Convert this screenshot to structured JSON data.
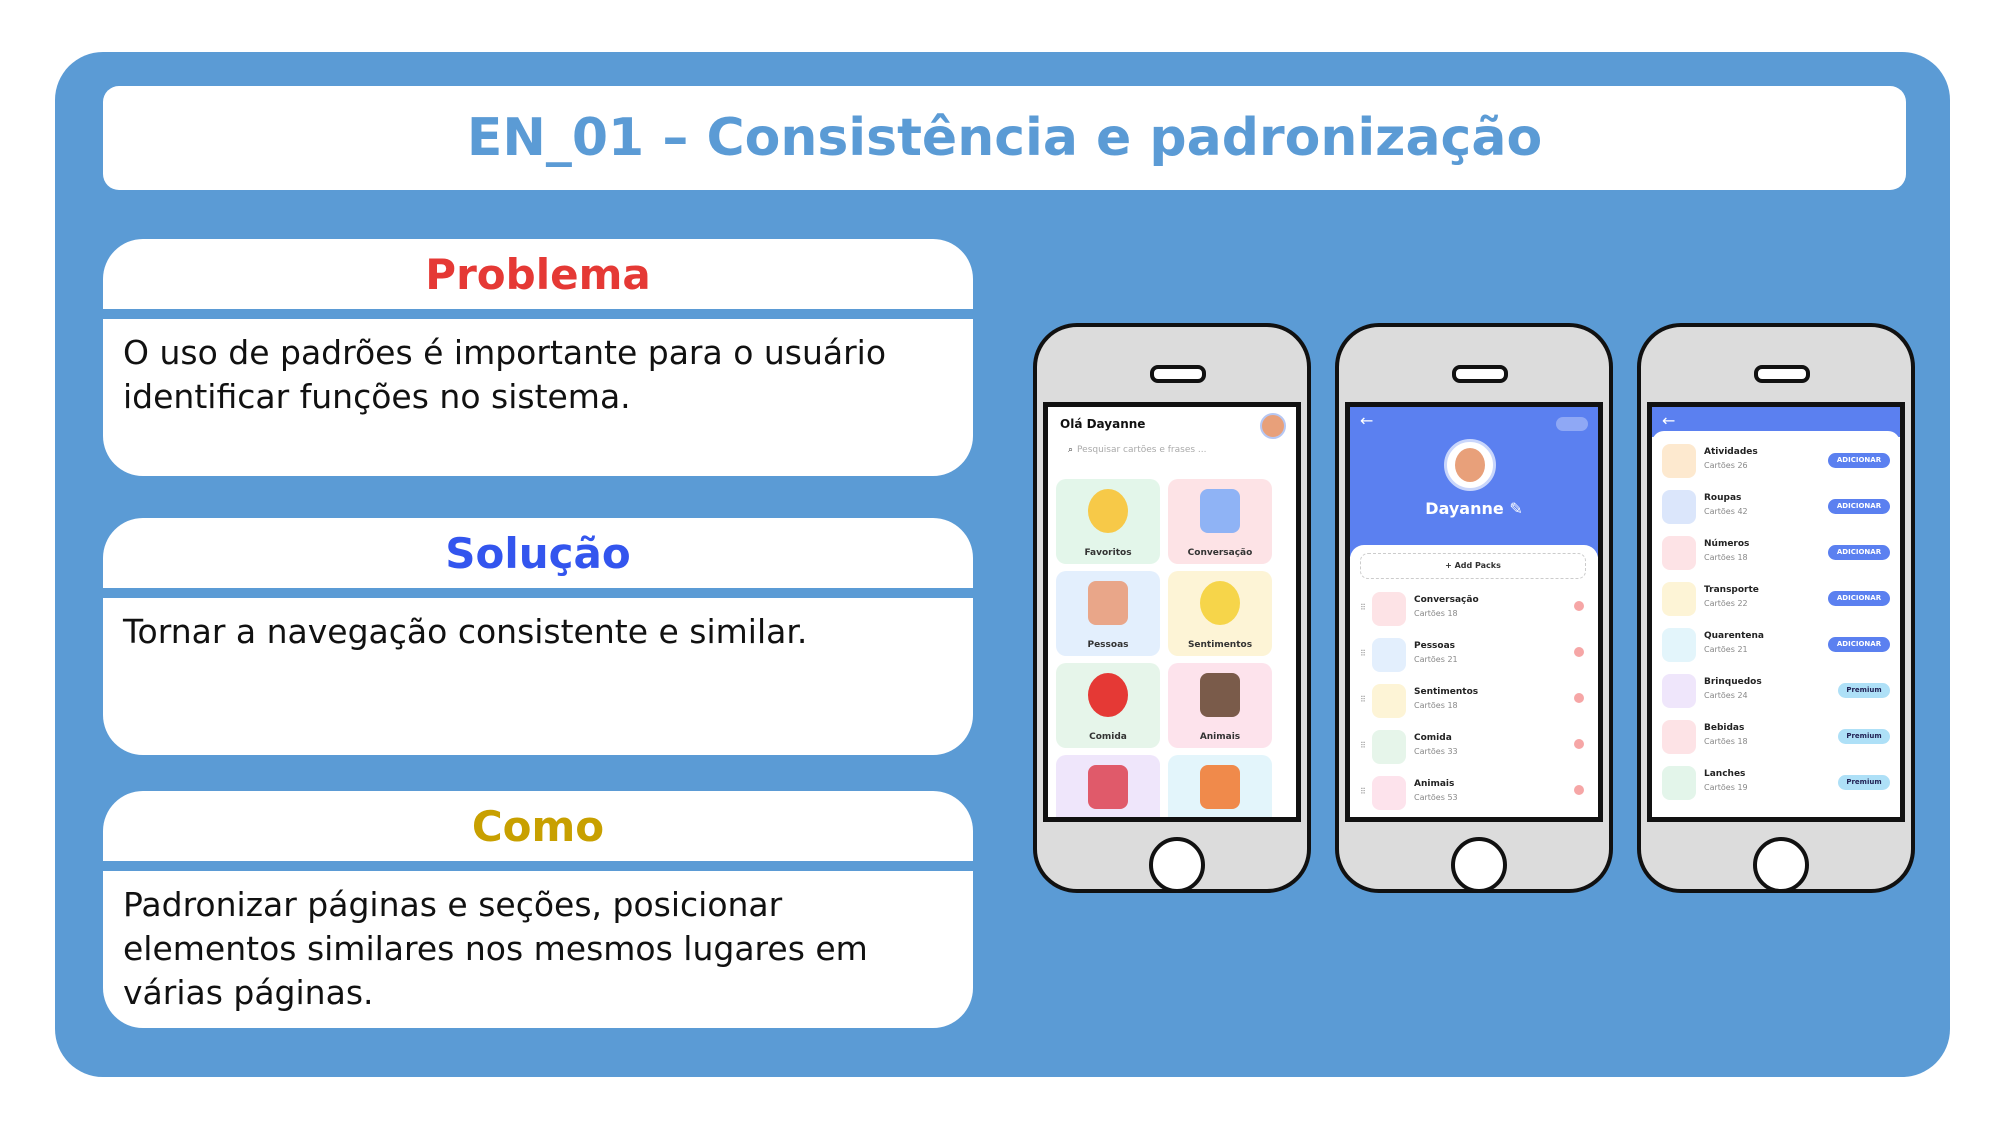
{
  "title": "EN_01 – Consistência e padronização",
  "cards": {
    "problema": {
      "heading": "Problema",
      "body": "O uso de padrões é importante para o usuário identificar funções no sistema.",
      "color": "#e53935"
    },
    "solucao": {
      "heading": "Solução",
      "body": "Tornar a navegação consistente e similar.",
      "color": "#3355ee"
    },
    "como": {
      "heading": "Como",
      "body": "Padronizar páginas e seções, posicionar elementos similares nos mesmos lugares em várias páginas.",
      "color": "#c8a000"
    }
  },
  "phone1": {
    "greeting": "Olá Dayanne",
    "search_placeholder": "Pesquisar cartões e frases ...",
    "tiles": [
      {
        "label": "Favoritos",
        "bg": "#e3f6ea",
        "icon": "star-icon",
        "icon_color": "#f7c948"
      },
      {
        "label": "Conversação",
        "bg": "#fde3e6",
        "icon": "chat-icon",
        "icon_color": "#8fb3f5"
      },
      {
        "label": "Pessoas",
        "bg": "#e3effd",
        "icon": "people-icon",
        "icon_color": "#e9a689"
      },
      {
        "label": "Sentimentos",
        "bg": "#fdf4d6",
        "icon": "emoji-icon",
        "icon_color": "#f6d54a"
      },
      {
        "label": "Comida",
        "bg": "#e6f5ea",
        "icon": "apple-icon",
        "icon_color": "#e53935"
      },
      {
        "label": "Animais",
        "bg": "#fde3ec",
        "icon": "dog-icon",
        "icon_color": "#7a5b4a"
      },
      {
        "label": "",
        "bg": "#efe6fb",
        "icon": "book-icon",
        "icon_color": "#e05a6a"
      },
      {
        "label": "",
        "bg": "#e3f5fb",
        "icon": "shapes-icon",
        "icon_color": "#f08a4b"
      }
    ]
  },
  "phone2": {
    "name": "Dayanne",
    "add_label": "+ Add Packs",
    "items": [
      {
        "name": "Conversação",
        "count": "Cartões 18",
        "bg": "#fde3e6"
      },
      {
        "name": "Pessoas",
        "count": "Cartões 21",
        "bg": "#e3effd"
      },
      {
        "name": "Sentimentos",
        "count": "Cartões 18",
        "bg": "#fdf4d6"
      },
      {
        "name": "Comida",
        "count": "Cartões 33",
        "bg": "#e6f5ea"
      },
      {
        "name": "Animais",
        "count": "Cartões 53",
        "bg": "#fde3ec"
      }
    ]
  },
  "phone3": {
    "items": [
      {
        "name": "Atividades",
        "count": "Cartões 26",
        "action": "ADICIONAR",
        "bg": "#fde9cf"
      },
      {
        "name": "Roupas",
        "count": "Cartões 42",
        "action": "ADICIONAR",
        "bg": "#dbe6fb"
      },
      {
        "name": "Números",
        "count": "Cartões 18",
        "action": "ADICIONAR",
        "bg": "#fde3e6"
      },
      {
        "name": "Transporte",
        "count": "Cartões 22",
        "action": "ADICIONAR",
        "bg": "#fdf4d6"
      },
      {
        "name": "Quarentena",
        "count": "Cartões 21",
        "action": "ADICIONAR",
        "bg": "#e3f5fb"
      },
      {
        "name": "Brinquedos",
        "count": "Cartões 24",
        "action": "Premium",
        "bg": "#efe6fb"
      },
      {
        "name": "Bebidas",
        "count": "Cartões 18",
        "action": "Premium",
        "bg": "#fde3e6"
      },
      {
        "name": "Lanches",
        "count": "Cartões 19",
        "action": "Premium",
        "bg": "#e3f5ea"
      }
    ]
  }
}
